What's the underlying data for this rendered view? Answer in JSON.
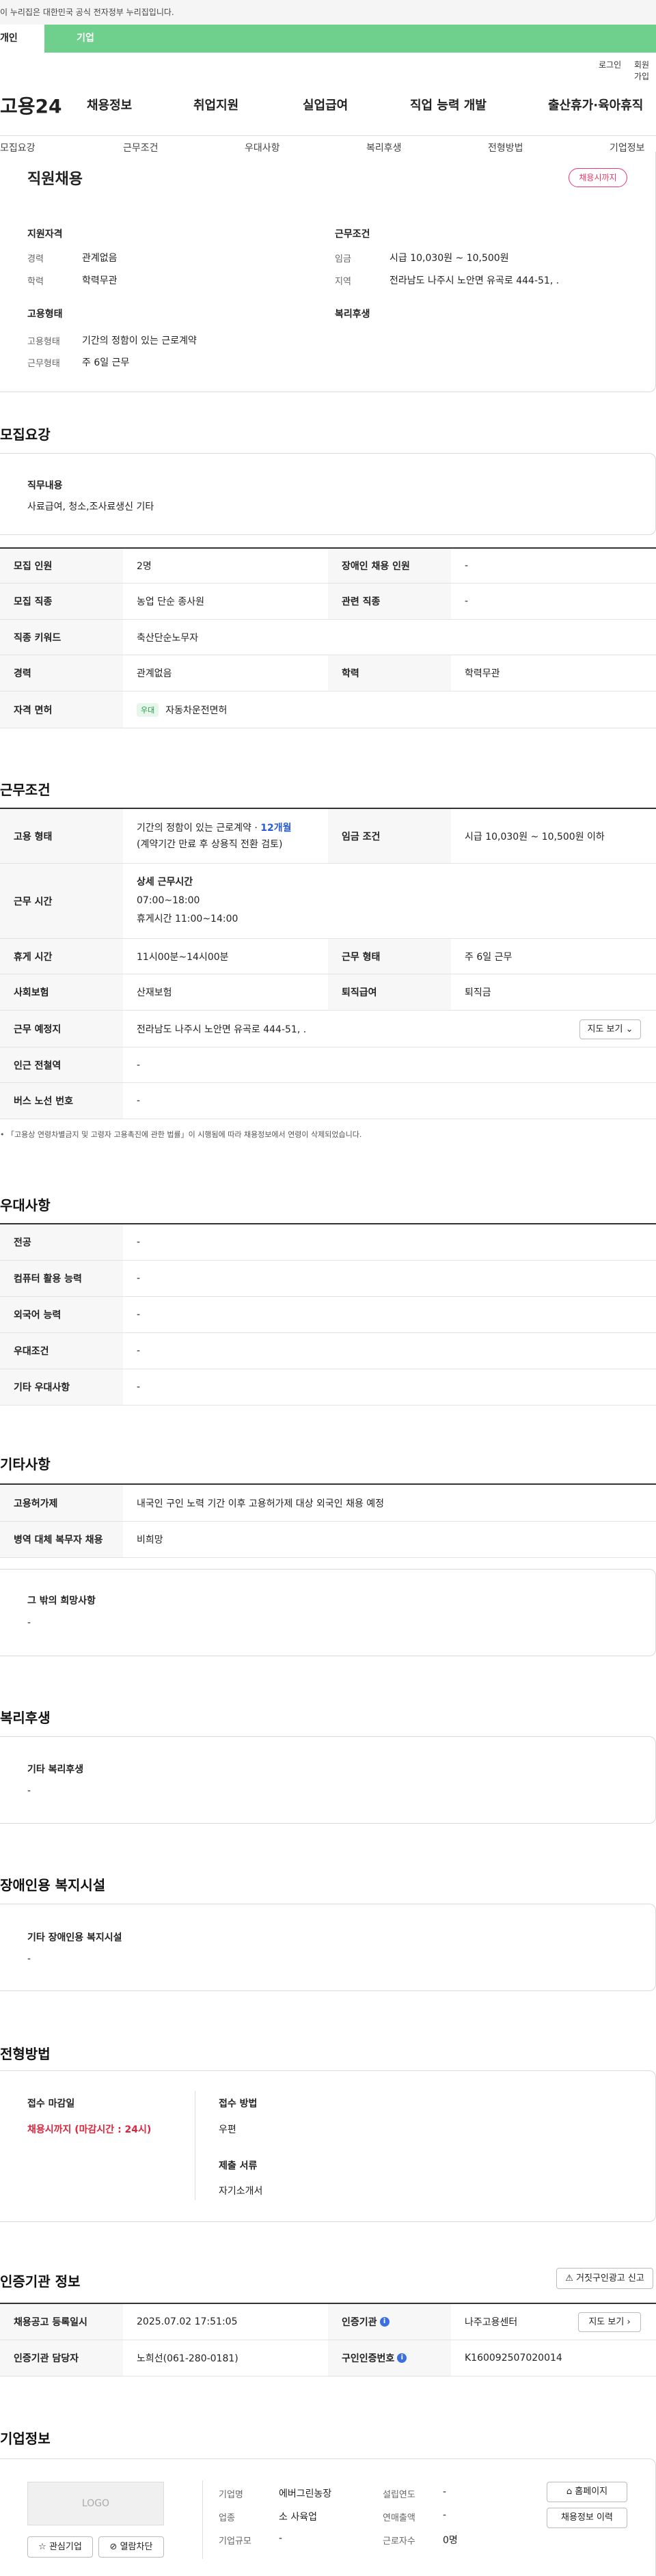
{
  "gov_banner": "이 누리집은 대한민국 공식 전자정부 누리집입니다.",
  "top_tabs": {
    "individual": "개인",
    "corp": "기업"
  },
  "util": {
    "login": "로그인",
    "join": "회원가입"
  },
  "brand": "고용24",
  "gnb": [
    "채용정보",
    "취업지원",
    "실업급여",
    "직업 능력 개발",
    "출산휴가·육아휴직"
  ],
  "subnav": [
    "모집요강",
    "근무조건",
    "우대사항",
    "복리후생",
    "전형방법",
    "기업정보"
  ],
  "summary": {
    "title": "직원채용",
    "badge": "채용시까지",
    "qual_title": "지원자격",
    "career_label": "경력",
    "career_value": "관계없음",
    "edu_label": "학력",
    "edu_value": "학력무관",
    "cond_title": "근무조건",
    "wage_label": "임금",
    "wage_value": "시급 10,030원 ~ 10,500원",
    "area_label": "지역",
    "area_value": "전라남도 나주시 노안면 유곡로 444-51, .",
    "emp_title": "고용형태",
    "emp_type_label": "고용형태",
    "emp_type_value": "기간의 정함이 있는 근로계약",
    "work_type_label": "근무형태",
    "work_type_value": "주 6일 근무",
    "welfare_title": "복리후생"
  },
  "recruit": {
    "heading": "모집요강",
    "duty_title": "직무내용",
    "duty_value": "사료급여, 청소,조사료생신 기타",
    "rows": [
      {
        "l1": "모집 인원",
        "v1": "2명",
        "l2": "장애인 채용 인원",
        "v2": "-"
      },
      {
        "l1": "모집 직종",
        "v1": "농업 단순 종사원",
        "l2": "관련 직종",
        "v2": "-"
      },
      {
        "l1": "직종 키워드",
        "v1": "축산단순노무자"
      },
      {
        "l1": "경력",
        "v1": "관계없음",
        "l2": "학력",
        "v2": "학력무관"
      },
      {
        "l1": "자격 면허",
        "tag": "우대",
        "v1": "자동차운전면허"
      }
    ]
  },
  "work": {
    "heading": "근무조건",
    "emp_label": "고용 형태",
    "emp_line1": "기간의 정함이 있는 근로계약 · ",
    "emp_months": "12개월",
    "emp_line2": "(계약기간 만료 후 상용직 전환 검토)",
    "wage_label": "임금 조건",
    "wage_value": "시급 10,030원 ~ 10,500원 이하",
    "time_label": "근무 시간",
    "time_title": "상세 근무시간",
    "time_hours": "07:00~18:00",
    "time_break": "휴게시간 11:00~14:00",
    "rest_label": "휴게 시간",
    "rest_value": "11시00분~14시00분",
    "shift_label": "근무 형태",
    "shift_value": "주 6일 근무",
    "ins_label": "사회보험",
    "ins_value": "산재보험",
    "pension_label": "퇴직급여",
    "pension_value": "퇴직금",
    "place_label": "근무 예정지",
    "place_value": "전라남도 나주시 노안면 유곡로 444-51, .",
    "map_btn": "지도 보기",
    "station_label": "인근 전철역",
    "station_value": "-",
    "bus_label": "버스 노선 번호",
    "bus_value": "-",
    "note": "「고용상 연령차별금지 및 고령자 고용촉진에 관한 법률」이 시행됨에 따라 채용정보에서 연령이 삭제되었습니다."
  },
  "pref": {
    "heading": "우대사항",
    "rows": [
      {
        "l": "전공",
        "v": "-"
      },
      {
        "l": "컴퓨터 활용 능력",
        "v": "-"
      },
      {
        "l": "외국어 능력",
        "v": "-"
      },
      {
        "l": "우대조건",
        "v": "-"
      },
      {
        "l": "기타 우대사항",
        "v": "-"
      }
    ]
  },
  "etc": {
    "heading": "기타사항",
    "rows": [
      {
        "l": "고용허가제",
        "v": "내국인 구인 노력 기간 이후 고용허가제 대상 외국인 채용 예정"
      },
      {
        "l": "병역 대체 복무자 채용",
        "v": "비희망"
      }
    ],
    "other_title": "그 밖의 희망사항",
    "other_value": "-"
  },
  "welfare": {
    "heading": "복리후생",
    "title": "기타 복리후생",
    "value": "-"
  },
  "disabled": {
    "heading": "장애인용 복지시설",
    "title": "기타 장애인용 복지시설",
    "value": "-"
  },
  "selection": {
    "heading": "전형방법",
    "deadline_title": "접수 마감일",
    "deadline_value": "채용시까지 (마감시간 : 24시)",
    "method_title": "접수 방법",
    "method_value": "우편",
    "docs_title": "제출 서류",
    "docs_value": "자기소개서"
  },
  "agency": {
    "heading": "인증기관 정보",
    "report_btn": "거짓구인광고 신고",
    "reg_label": "채용공고 등록일시",
    "reg_value": "2025.07.02 17:51:05",
    "org_label": "인증기관",
    "org_value": "나주고용센터",
    "map_btn": "지도 보기",
    "mgr_label": "인증기관 담당자",
    "mgr_value": "노희선(061-280-0181)",
    "num_label": "구인인증번호",
    "num_value": "K160092507020014"
  },
  "company": {
    "heading": "기업정보",
    "logo": "LOGO",
    "fav_btn": "관심기업",
    "block_btn": "열람차단",
    "name_label": "기업명",
    "name_value": "에버그린농장",
    "industry_label": "업종",
    "industry_value": "소 사육업",
    "size_label": "기업규모",
    "size_value": "-",
    "founded_label": "설립연도",
    "founded_value": "-",
    "sales_label": "연매출액",
    "sales_value": "-",
    "staff_label": "근로자수",
    "staff_value": "0명",
    "home_btn": "홈페이지",
    "history_btn": "채용정보 이력"
  }
}
